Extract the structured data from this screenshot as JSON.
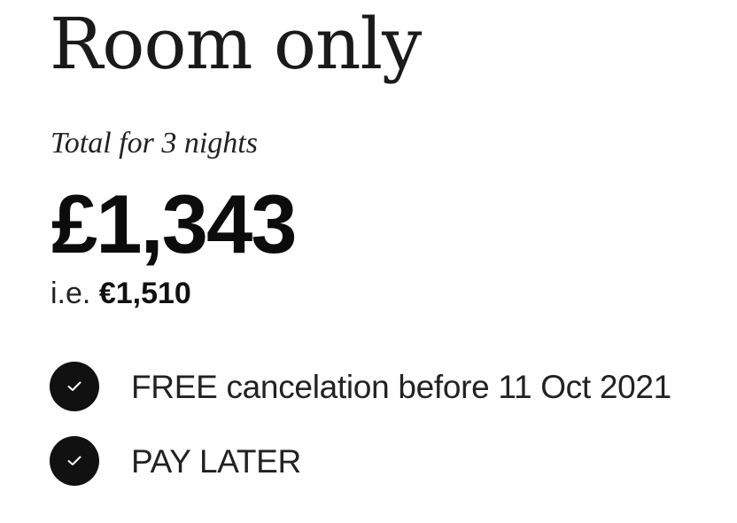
{
  "offer": {
    "title": "Room only",
    "subtitle": "Total for 3 nights",
    "price": "£1,343",
    "alt_price_prefix": "i.e. ",
    "alt_price_amount": "€1,510"
  },
  "features": [
    {
      "label": "FREE cancelation before 11 Oct 2021",
      "icon": "check-icon"
    },
    {
      "label": "PAY LATER",
      "icon": "check-icon"
    }
  ],
  "colors": {
    "text": "#111111",
    "icon_background": "#111111",
    "icon_check": "#ffffff"
  }
}
